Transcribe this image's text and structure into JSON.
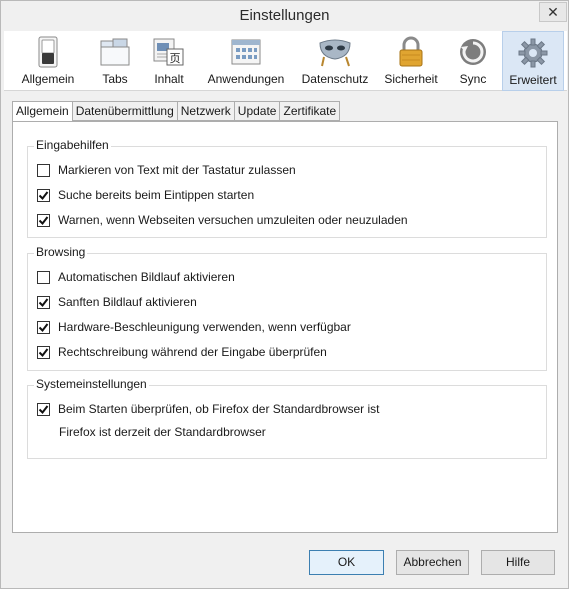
{
  "window": {
    "title": "Einstellungen",
    "close_symbol": "✕"
  },
  "toolbar": {
    "items": [
      {
        "label": "Allgemein",
        "icon": "switch-icon"
      },
      {
        "label": "Tabs",
        "icon": "tabs-icon"
      },
      {
        "label": "Inhalt",
        "icon": "content-icon"
      },
      {
        "label": "Anwendungen",
        "icon": "applications-icon"
      },
      {
        "label": "Datenschutz",
        "icon": "mask-icon"
      },
      {
        "label": "Sicherheit",
        "icon": "padlock-icon"
      },
      {
        "label": "Sync",
        "icon": "sync-icon"
      },
      {
        "label": "Erweitert",
        "icon": "gear-icon",
        "active": true
      }
    ]
  },
  "tabs": [
    {
      "label": "Allgemein",
      "active": true
    },
    {
      "label": "Datenübermittlung"
    },
    {
      "label": "Netzwerk"
    },
    {
      "label": "Update"
    },
    {
      "label": "Zertifikate"
    }
  ],
  "groups": {
    "accessibility": {
      "title": "Eingabehilfen",
      "options": [
        {
          "label": "Markieren von Text mit der Tastatur zulassen",
          "checked": false
        },
        {
          "label": "Suche bereits beim Eintippen starten",
          "checked": true
        },
        {
          "label": "Warnen, wenn Webseiten versuchen umzuleiten oder neuzuladen",
          "checked": true
        }
      ]
    },
    "browsing": {
      "title": "Browsing",
      "options": [
        {
          "label": "Automatischen Bildlauf aktivieren",
          "checked": false
        },
        {
          "label": "Sanften Bildlauf aktivieren",
          "checked": true
        },
        {
          "label": "Hardware-Beschleunigung verwenden, wenn verfügbar",
          "checked": true
        },
        {
          "label": "Rechtschreibung während der Eingabe überprüfen",
          "checked": true
        }
      ]
    },
    "system": {
      "title": "Systemeinstellungen",
      "options": [
        {
          "label": "Beim Starten überprüfen, ob Firefox der Standardbrowser ist",
          "checked": true
        }
      ],
      "status": "Firefox ist derzeit der Standardbrowser"
    }
  },
  "buttons": {
    "ok": "OK",
    "cancel": "Abbrechen",
    "help": "Hilfe"
  }
}
